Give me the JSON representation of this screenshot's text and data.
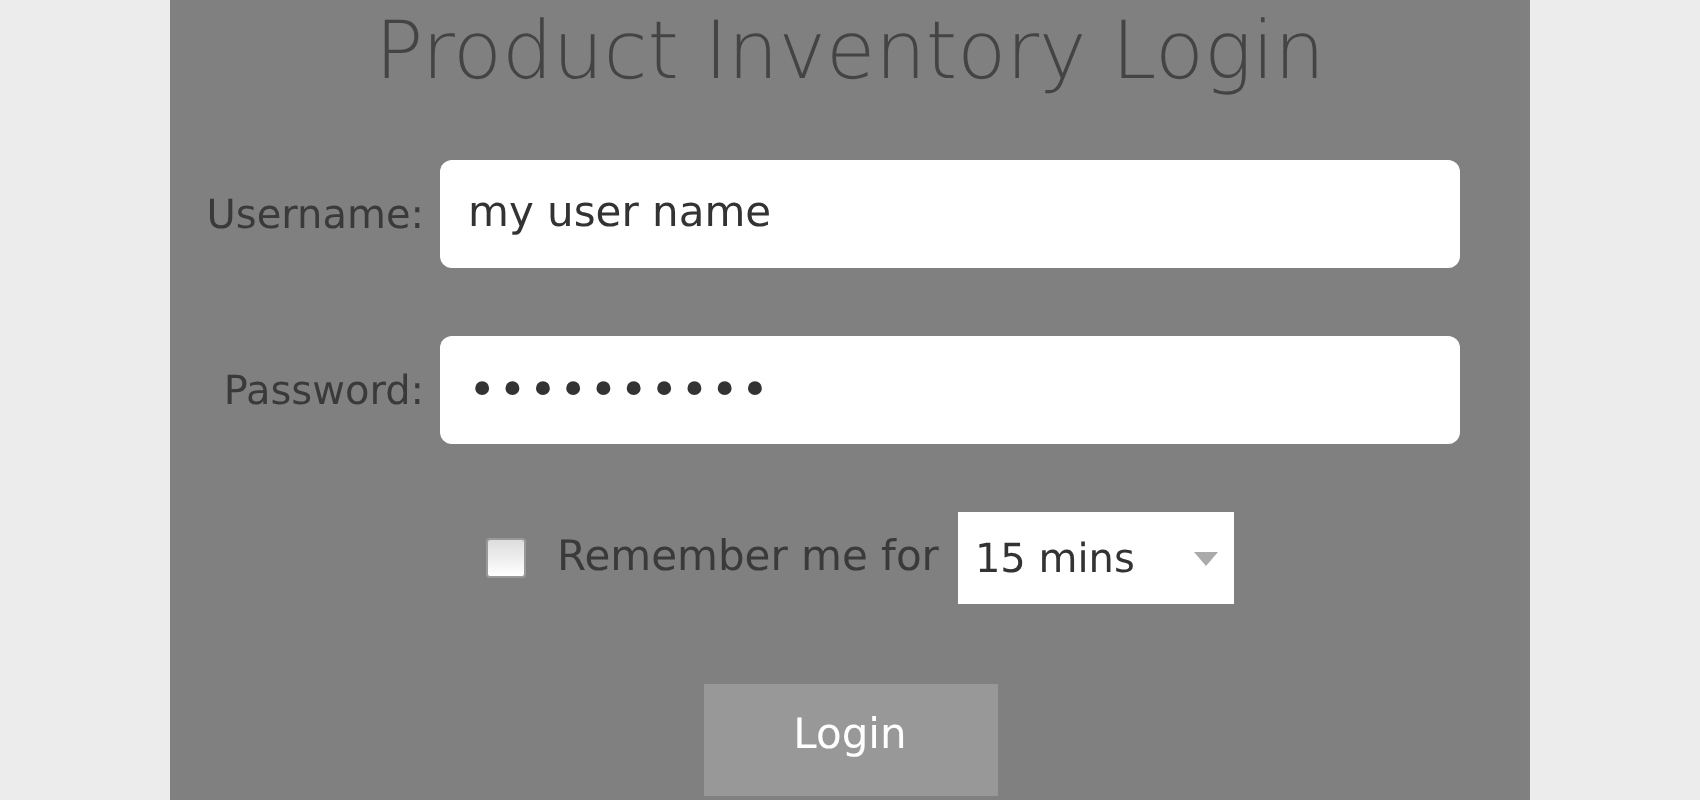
{
  "title": "Product Inventory Login",
  "fields": [
    {
      "label": "Username:",
      "value": "my user name",
      "kind": "text"
    },
    {
      "label": "Password:",
      "value": "••••••••••",
      "kind": "password"
    }
  ],
  "remember": {
    "checked": false,
    "label": "Remember me for",
    "duration": "15 mins"
  },
  "button": "Login"
}
